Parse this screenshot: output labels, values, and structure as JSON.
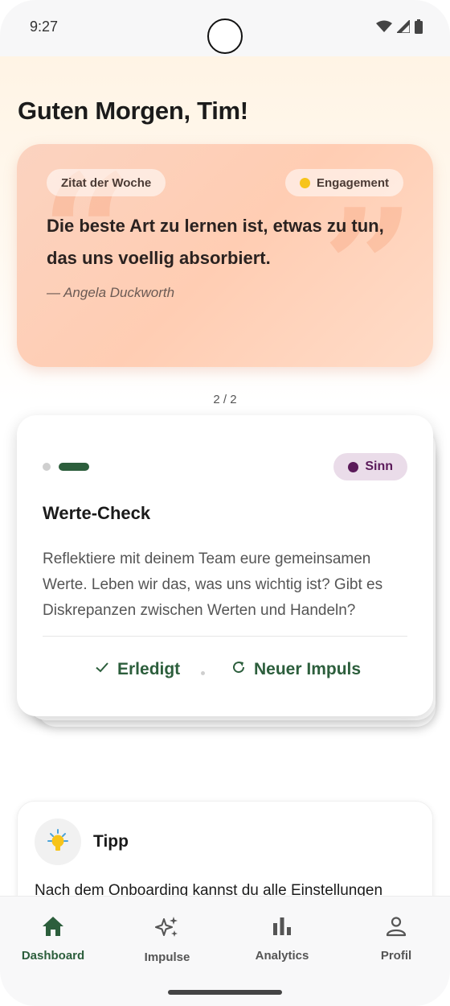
{
  "status_bar": {
    "time": "9:27"
  },
  "header": {
    "greeting": "Guten Morgen, Tim!"
  },
  "quote_card": {
    "label": "Zitat der Woche",
    "category": "Engagement",
    "category_color": "#f7c41a",
    "text": "Die beste Art zu lernen ist, etwas zu tun, das uns voellig absorbiert.",
    "author": "— Angela Duckworth",
    "pager": "2 / 2"
  },
  "impulse_card": {
    "tag": "Sinn",
    "tag_color": "#5b1a5a",
    "title": "Werte-Check",
    "body": "Reflektiere mit deinem Team eure gemeinsamen Werte. Leben wir das, was uns wichtig ist? Gibt es Diskrepanzen zwischen Werten und Handeln?",
    "done_label": "Erledigt",
    "new_label": "Neuer Impuls",
    "accent": "#2c5e3c"
  },
  "tip_card": {
    "title": "Tipp",
    "text": "Nach dem Onboarding kannst du alle Einstellungen"
  },
  "nav": {
    "items": [
      {
        "label": "Dashboard",
        "icon": "home-icon",
        "active": true
      },
      {
        "label": "Impulse",
        "icon": "sparkles-icon",
        "active": false
      },
      {
        "label": "Analytics",
        "icon": "bar-chart-icon",
        "active": false
      },
      {
        "label": "Profil",
        "icon": "person-icon",
        "active": false
      }
    ]
  }
}
